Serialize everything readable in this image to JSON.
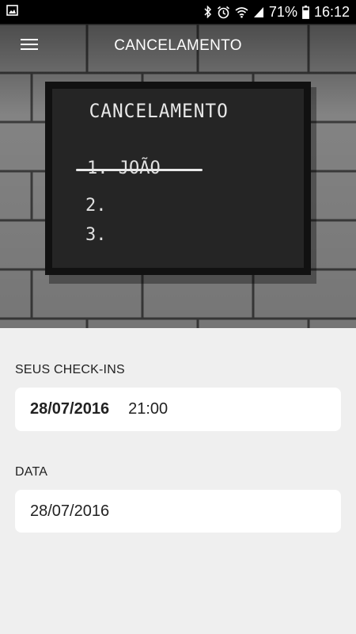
{
  "status_bar": {
    "battery": "71%",
    "time": "16:12",
    "icons": [
      "gallery-icon",
      "bluetooth-icon",
      "alarm-icon",
      "wifi-icon",
      "signal-icon",
      "battery-icon"
    ]
  },
  "app_bar": {
    "title": "CANCELAMENTO",
    "menu_icon": "hamburger-menu-icon"
  },
  "hero": {
    "board_heading": "CANCELAMENTO",
    "board_lines": [
      "1. JOÃO",
      "2.",
      "3."
    ]
  },
  "checkins": {
    "label": "SEUS CHECK-INS",
    "date": "28/07/2016",
    "time": "21:00"
  },
  "date_section": {
    "label": "DATA",
    "value": "28/07/2016"
  }
}
